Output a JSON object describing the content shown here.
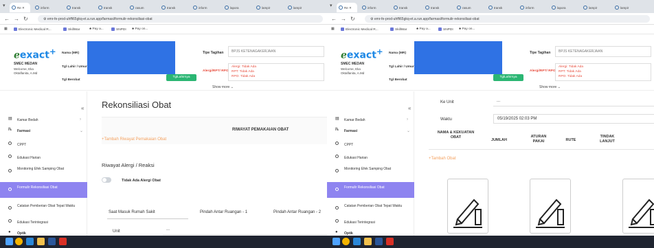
{
  "browser": {
    "tabs": [
      "Re",
      "inform",
      "transk",
      "transk",
      "rasum",
      "transk",
      "inform",
      "lapora",
      "lampir",
      "lampir"
    ],
    "url": "emr-fe-prod-uhffi65gkq-et.a.run.app/farmasi/formulir-rekonsiliasi-obat",
    "bookmarks": [
      "Electronic Medical R...",
      "SkillWar",
      "Pay a...",
      "SNPDI",
      "Pay on..."
    ]
  },
  "header": {
    "logo": "exact",
    "org": "SMEC MEDAN",
    "welcome": "Welcome, Eka Oktaflanita, A.Md",
    "label_nama": "Nama (MR)",
    "label_tgl_lahir": "Tgl Lahir / Umur",
    "label_tgl_berobat": "Tgl Berobat",
    "tgl_button": "TglLahirnya",
    "label_tipe": "Tipe Tagihan",
    "tipe_value": "BPJS KETENAGAKERJAAN",
    "label_alergi": "Alergi/RPT/ RPO",
    "alergi_lines": [
      "Alergi: Tidak Ada",
      "RPT: Tidak Ada",
      "RPO: Tidak Ada"
    ],
    "show_more": "Show more"
  },
  "sidebar": {
    "items": [
      {
        "label": "Kamar Bedah"
      },
      {
        "label": "Farmasi"
      },
      {
        "label": "CPPT"
      },
      {
        "label": "Edukasi Harian"
      },
      {
        "label": "Monitoring Efek Samping Obat"
      },
      {
        "label": "Formulir Rekonsiliasi Obat"
      },
      {
        "label": "Catatan Pemberian Obat Tepat Waktu"
      },
      {
        "label": "Edukasi Terintegrasi"
      },
      {
        "label": "Optik"
      }
    ]
  },
  "left_main": {
    "title": "Rekonsiliasi Obat",
    "riwayat_header": "RIWAYAT PEMAKAIAN OBAT",
    "add_riwayat": "+Tambah Riwayat Pemakaian Obat",
    "alergi_section": "Riwayat Alergi / Reaksi",
    "toggle_label": "Tidak Ada Alergi Obat",
    "tabs": [
      "Saat Masuk Rumah Sakit",
      "Pindah Antar Ruangan - 1",
      "Pindah Antar Ruangan - 2"
    ],
    "unit_label": "Unit",
    "unit_value": "..."
  },
  "right_main": {
    "ke_unit_label": "Ke Unit",
    "ke_unit_value": "...",
    "waktu_label": "Waktu",
    "waktu_value": "05/19/2025 02:03 PM",
    "columns": [
      "NAMA & KEKUATAN OBAT",
      "JUMLAH",
      "ATURAN PAKAI",
      "RUTE",
      "TINDAK LANJUT"
    ],
    "add_obat": "+Tambah Obat"
  },
  "colors": {
    "accent": "#8e84f0",
    "link_orange": "#f4a261",
    "alert_red": "#e74c3c",
    "button_green": "#2bb673",
    "redaction_blue": "#2f72e4"
  }
}
